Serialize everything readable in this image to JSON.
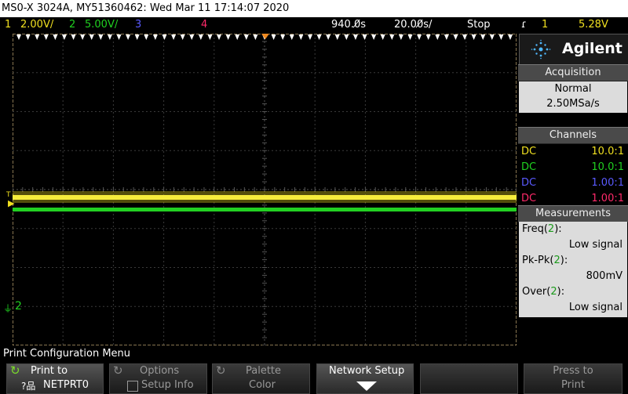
{
  "titlebar": {
    "text": "MS0-X 3024A, MY51360462: Wed Mar 11 17:14:07 2020"
  },
  "status": {
    "ch1_num": "1",
    "ch1_scale": "2.00V/",
    "ch2_num": "2",
    "ch2_scale": "5.00V/",
    "ch3_num": "3",
    "ch4_num": "4",
    "time_delay": "940.0̸s",
    "time_scale": "20.00̸s/",
    "run_state": "Stop",
    "trig_icon": "ɾ",
    "trig_channel": "1",
    "trig_level": "5.28V",
    "colors": {
      "ch1": "#f0e020",
      "ch2": "#20d020",
      "ch3": "#5a5aff",
      "ch4": "#ff2a6a"
    }
  },
  "graticule": {
    "ground_marker": "2",
    "ch1_marker": "T"
  },
  "panel": {
    "brand": "Agilent",
    "acquisition": {
      "header": "Acquisition",
      "mode": "Normal",
      "rate": "2.50MSa/s"
    },
    "channels": {
      "header": "Channels",
      "rows": [
        {
          "coupling": "DC",
          "probe": "10.0:1"
        },
        {
          "coupling": "DC",
          "probe": "10.0:1"
        },
        {
          "coupling": "DC",
          "probe": "1.00:1"
        },
        {
          "coupling": "DC",
          "probe": "1.00:1"
        }
      ]
    },
    "measurements": {
      "header": "Measurements",
      "items": [
        {
          "label_prefix": "Freq(",
          "channel": "2",
          "label_suffix": "):",
          "value": "Low signal"
        },
        {
          "label_prefix": "Pk-Pk(",
          "channel": "2",
          "label_suffix": "):",
          "value": "800mV"
        },
        {
          "label_prefix": "Over(",
          "channel": "2",
          "label_suffix": "):",
          "value": "Low signal"
        }
      ]
    }
  },
  "menu": {
    "title": "Print Configuration Menu",
    "keys": [
      {
        "line1": "Print to",
        "line2": "NETPRT0",
        "icon": "refresh-icon"
      },
      {
        "line1": "Options",
        "line2": "Setup Info",
        "icon": "refresh-icon"
      },
      {
        "line1": "Palette",
        "line2": "Color",
        "icon": "refresh-icon"
      },
      {
        "line1": "Network Setup",
        "line2": "",
        "icon": "down-arrow-icon"
      },
      {
        "line1": "",
        "line2": ""
      },
      {
        "line1": "Press to",
        "line2": "Print"
      }
    ]
  }
}
